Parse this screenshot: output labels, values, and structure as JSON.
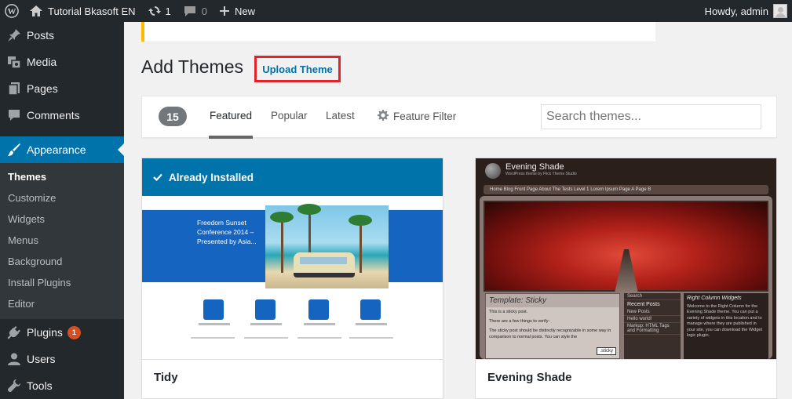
{
  "adminbar": {
    "site_name": "Tutorial Bkasoft EN",
    "updates_count": "1",
    "comments_count": "0",
    "new_label": "New",
    "howdy": "Howdy, admin"
  },
  "sidebar": {
    "items_top": [
      {
        "label": "Posts",
        "icon": "pin-icon"
      },
      {
        "label": "Media",
        "icon": "media-icon"
      },
      {
        "label": "Pages",
        "icon": "pages-icon"
      },
      {
        "label": "Comments",
        "icon": "comments-icon"
      }
    ],
    "current": {
      "label": "Appearance",
      "icon": "brush-icon"
    },
    "submenu": [
      "Themes",
      "Customize",
      "Widgets",
      "Menus",
      "Background",
      "Install Plugins",
      "Editor"
    ],
    "items_bottom": [
      {
        "label": "Plugins",
        "icon": "plug-icon",
        "badge": "1"
      },
      {
        "label": "Users",
        "icon": "users-icon"
      },
      {
        "label": "Tools",
        "icon": "wrench-icon"
      }
    ]
  },
  "page": {
    "title": "Add Themes",
    "upload_button": "Upload Theme"
  },
  "filter": {
    "count": "15",
    "tabs": [
      "Featured",
      "Popular",
      "Latest"
    ],
    "active_tab": "Featured",
    "feature_filter": "Feature Filter",
    "search_placeholder": "Search themes..."
  },
  "themes": [
    {
      "name": "Tidy",
      "installed_label": "Already Installed",
      "preview": {
        "hero_text": "Freedom Sunset Conference  2014 – Presented by Asia..."
      }
    },
    {
      "name": "Evening Shade",
      "preview": {
        "title": "Evening Shade",
        "subtitle": "WordPress theme by Flick Theme Studio",
        "nav": "Home   Blog   Front Page   About The Tests   Level 1   Lorem Ipsum   Page A   Page B",
        "post_title": "Template: Sticky",
        "post_lines": [
          "This is a sticky post.",
          "There are a few things to verify:",
          "The sticky post should be distinctly recognizable in some way in comparison to normal posts. You can style the"
        ],
        "sticky_tag": ".sticky",
        "search_btn": "Search",
        "recent_heading": "Recent Posts",
        "recent_items": [
          "New Posts",
          "Hello world!",
          "Markup: HTML Tags and Formatting"
        ],
        "right_heading": "Right Column Widgets",
        "right_text": "Welcome to the Right Column for the Evening Shade theme. You can put a variety of widgets in this location and to manage where they are published in your site, you can download the Widget logic plugin."
      }
    }
  ],
  "colors": {
    "adminbar_bg": "#23282d",
    "accent": "#0073aa",
    "upload_highlight": "#e2232a",
    "notice_border": "#ffb900"
  }
}
